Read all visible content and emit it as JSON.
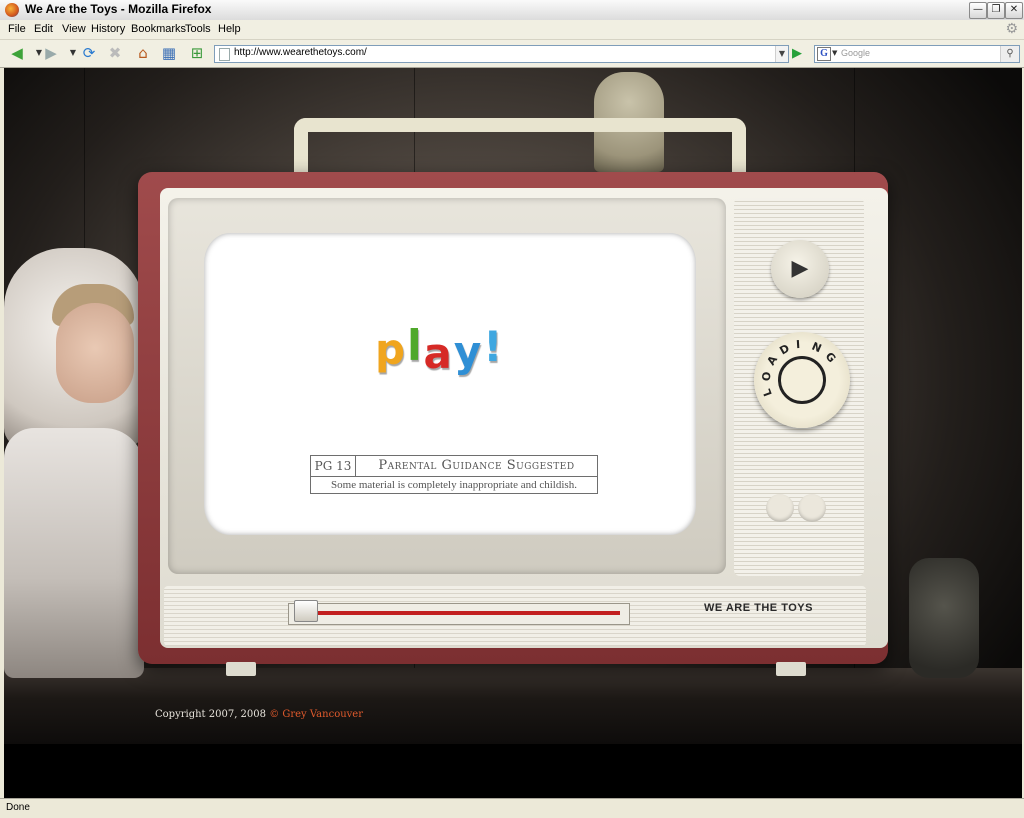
{
  "window": {
    "title": "We Are the Toys - Mozilla Firefox"
  },
  "menu": [
    "File",
    "Edit",
    "View",
    "History",
    "Bookmarks",
    "Tools",
    "Help"
  ],
  "navbar": {
    "url": "http://www.wearethetoys.com/",
    "search_placeholder": "Google",
    "search_engine_glyph": "G"
  },
  "tv": {
    "logo_letters": [
      {
        "ch": "p",
        "color": "#f0a51e"
      },
      {
        "ch": "l",
        "color": "#4fa82b"
      },
      {
        "ch": "a",
        "color": "#d62a26"
      },
      {
        "ch": "y",
        "color": "#2f8fd5"
      },
      {
        "ch": "!",
        "color": "#3fa7e0"
      }
    ],
    "rating": {
      "code": "PG 13",
      "label": "Parental Guidance Suggested",
      "note": "Some material is completely inappropriate and childish."
    },
    "dial_label": "LOADING",
    "brand": "WE ARE THE TOYS"
  },
  "footer": {
    "copyright": "Copyright 2007, 2008",
    "credit": "© Grey Vancouver"
  },
  "status": {
    "text": "Done"
  },
  "colors": {
    "credit_link": "#e05a2c",
    "slider_fill": "#c21f1f"
  }
}
